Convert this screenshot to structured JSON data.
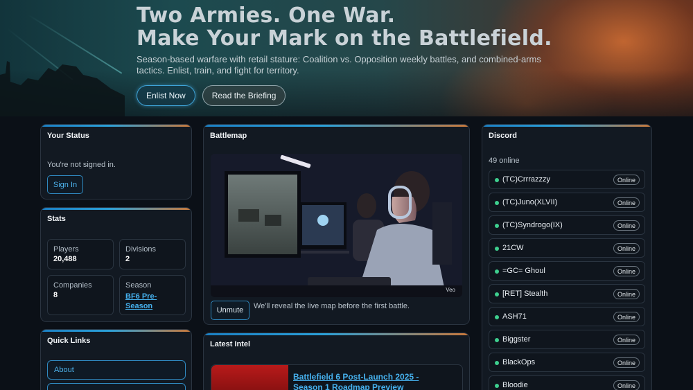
{
  "hero": {
    "title_line1": "Two Armies. One War.",
    "title_line2": "Make Your Mark on the Battlefield.",
    "subtitle": "Season-based warfare with retail stature: Coalition vs. Opposition weekly battles, and combined-arms tactics. Enlist, train, and fight for territory.",
    "enlist_label": "Enlist Now",
    "briefing_label": "Read the Briefing"
  },
  "status": {
    "title": "Your Status",
    "message": "You're not signed in.",
    "signin_label": "Sign In"
  },
  "stats": {
    "title": "Stats",
    "players_label": "Players",
    "players_value": "20,488",
    "divisions_label": "Divisions",
    "divisions_value": "2",
    "companies_label": "Companies",
    "companies_value": "8",
    "season_label": "Season",
    "season_value": "BF6 Pre-Season"
  },
  "quick_links": {
    "title": "Quick Links",
    "items": [
      "About",
      ""
    ]
  },
  "battlemap": {
    "title": "Battlemap",
    "watermark": "Veo",
    "unmute_label": "Unmute",
    "note": "We'll reveal the live map before the first battle."
  },
  "intel": {
    "title": "Latest Intel",
    "headline": "Battlefield 6 Post-Launch 2025 - Season 1 Roadmap Preview"
  },
  "discord": {
    "title": "Discord",
    "online_count": "49 online",
    "badge_label": "Online",
    "members": [
      "(TC)Crrrazzzy",
      "(TC)Juno(XLVII)",
      "(TC)Syndrogo(IX)",
      "21CW",
      "=GC= Ghoul",
      "[RET] Stealth",
      "ASH71",
      "Biggster",
      "BlackOps",
      "Bloodie"
    ]
  },
  "colors": {
    "accent_blue": "#2f89c0",
    "link_blue": "#46b1ee",
    "online_green": "#3ecf8e",
    "accent_orange": "#c9783a"
  }
}
